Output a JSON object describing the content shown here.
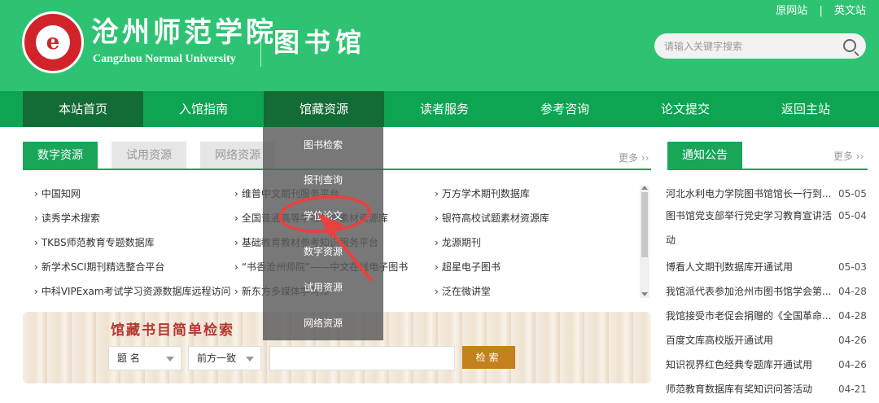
{
  "header": {
    "school_cn": "沧州师范学院",
    "school_en": "Cangzhou Normal University",
    "library_title": "图书馆",
    "logo_glyph": "e",
    "links": [
      "原网站",
      "英文站"
    ],
    "link_sep": "|",
    "search_placeholder": "请输入关键字搜索"
  },
  "nav": {
    "items": [
      "本站首页",
      "入馆指南",
      "馆藏资源",
      "读者服务",
      "参考咨询",
      "论文提交",
      "返回主站"
    ]
  },
  "dropdown": {
    "items": [
      "图书检索",
      "报刊查询",
      "学位论文",
      "数字资源",
      "试用资源",
      "网络资源"
    ]
  },
  "resources": {
    "tabs": [
      "数字资源",
      "试用资源",
      "网络资源"
    ],
    "more": "更多 ››",
    "rows": [
      [
        "中国知网",
        "维普中文期刊服务平台",
        "万方学术期刊数据库"
      ],
      [
        "读秀学术搜索",
        "全国普通高等学校教学素材资源库",
        "银符高校试题素材资源库"
      ],
      [
        "TKBS师范教育专题数据库",
        "基础教育教材参考知识服务平台",
        "龙源期刊"
      ],
      [
        "新学术SCI期刊精选整合平台",
        "“书香沧州师院”——中文在线电子图书",
        "超星电子图书"
      ],
      [
        "中科VIPExam考试学习资源数据库远程访问",
        "新东方多媒体学习库",
        "泛在微讲堂"
      ]
    ]
  },
  "catalog": {
    "title": "馆藏书目简单检索",
    "field_select": "题 名",
    "match_select": "前方一致",
    "query_value": "",
    "search_label": "检索"
  },
  "notices": {
    "title": "通知公告",
    "more": "更多 ››",
    "items": [
      {
        "title": "河北水利电力学院图书馆馆长一行到...",
        "date": "05-05"
      },
      {
        "title": "图书馆党支部举行党史学习教育宣讲活动",
        "date": "05-04"
      },
      {
        "title": "博看人文期刊数据库开通试用",
        "date": "05-03"
      },
      {
        "title": "我馆派代表参加沧州市图书馆学会第...",
        "date": "04-28"
      },
      {
        "title": "我馆接受市老促会捐赠的《全国革命...",
        "date": "04-28"
      },
      {
        "title": "百度文库高校版开通试用",
        "date": "04-26"
      },
      {
        "title": "知识视界红色经典专题库开通试用",
        "date": "04-26"
      },
      {
        "title": "师范教育数据库有奖知识问答活动",
        "date": "04-21"
      }
    ]
  },
  "colors": {
    "header_green": "#2ec373",
    "nav_green": "#0ea552",
    "nav_active": "#136b36",
    "accent_green": "#19a659",
    "annotation_red": "#e8413f",
    "catalog_title": "#b5352f",
    "search_button": "#c3801c"
  }
}
